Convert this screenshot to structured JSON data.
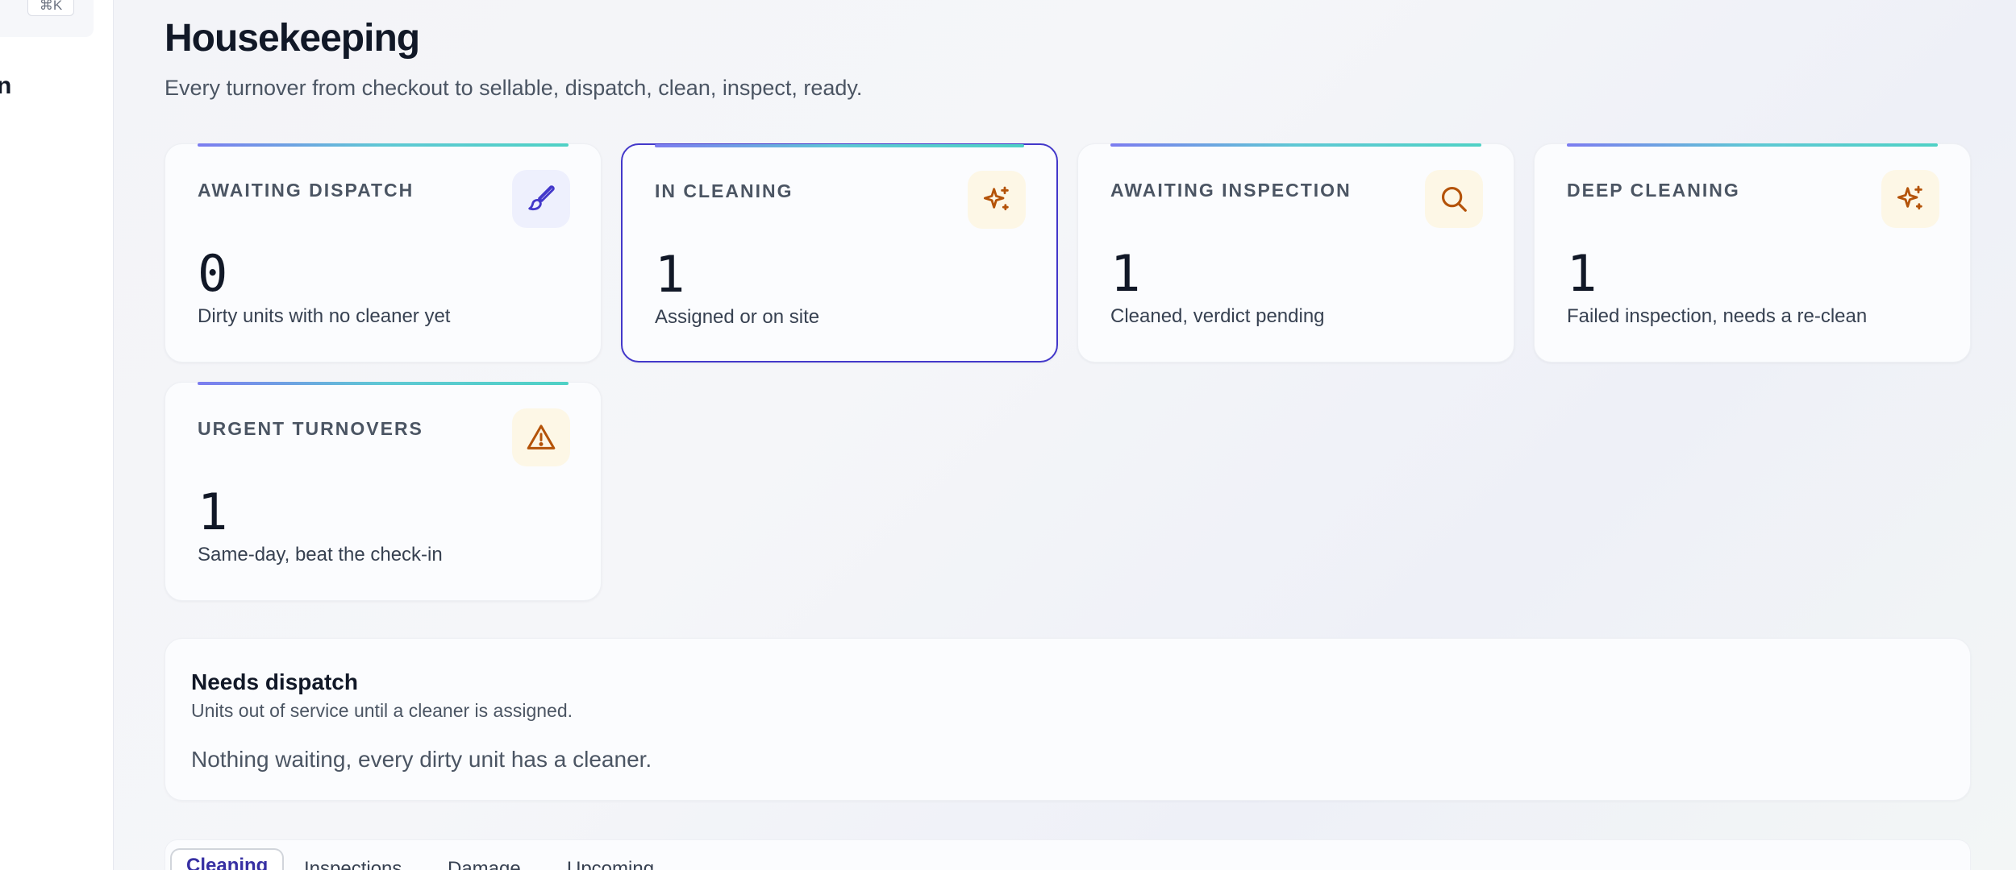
{
  "sidebar": {
    "search_shortcut": "⌘K",
    "fragment_text": "n"
  },
  "header": {
    "title": "Housekeeping",
    "subtitle": "Every turnover from checkout to sellable, dispatch, clean, inspect, ready."
  },
  "stats": [
    {
      "label": "AWAITING DISPATCH",
      "value": "0",
      "description": "Dirty units with no cleaner yet",
      "icon": "brush-icon",
      "active": false
    },
    {
      "label": "IN CLEANING",
      "value": "1",
      "description": "Assigned or on site",
      "icon": "sparkle-icon",
      "active": true
    },
    {
      "label": "AWAITING INSPECTION",
      "value": "1",
      "description": "Cleaned, verdict pending",
      "icon": "search-icon",
      "active": false
    },
    {
      "label": "DEEP CLEANING",
      "value": "1",
      "description": "Failed inspection, needs a re-clean",
      "icon": "sparkle-icon",
      "active": false
    },
    {
      "label": "URGENT TURNOVERS",
      "value": "1",
      "description": "Same-day, beat the check-in",
      "icon": "warning-icon",
      "active": false
    }
  ],
  "dispatch_panel": {
    "title": "Needs dispatch",
    "subtitle": "Units out of service until a cleaner is assigned.",
    "empty_message": "Nothing waiting, every dirty unit has a cleaner."
  },
  "tabs": [
    {
      "label": "Cleaning",
      "active": true
    },
    {
      "label": "Inspections",
      "active": false
    },
    {
      "label": "Damage",
      "active": false
    },
    {
      "label": "Upcoming",
      "active": false
    }
  ],
  "colors": {
    "accent": "#4338ca",
    "icon_blue": "#4338ca",
    "icon_amber": "#b45309"
  }
}
